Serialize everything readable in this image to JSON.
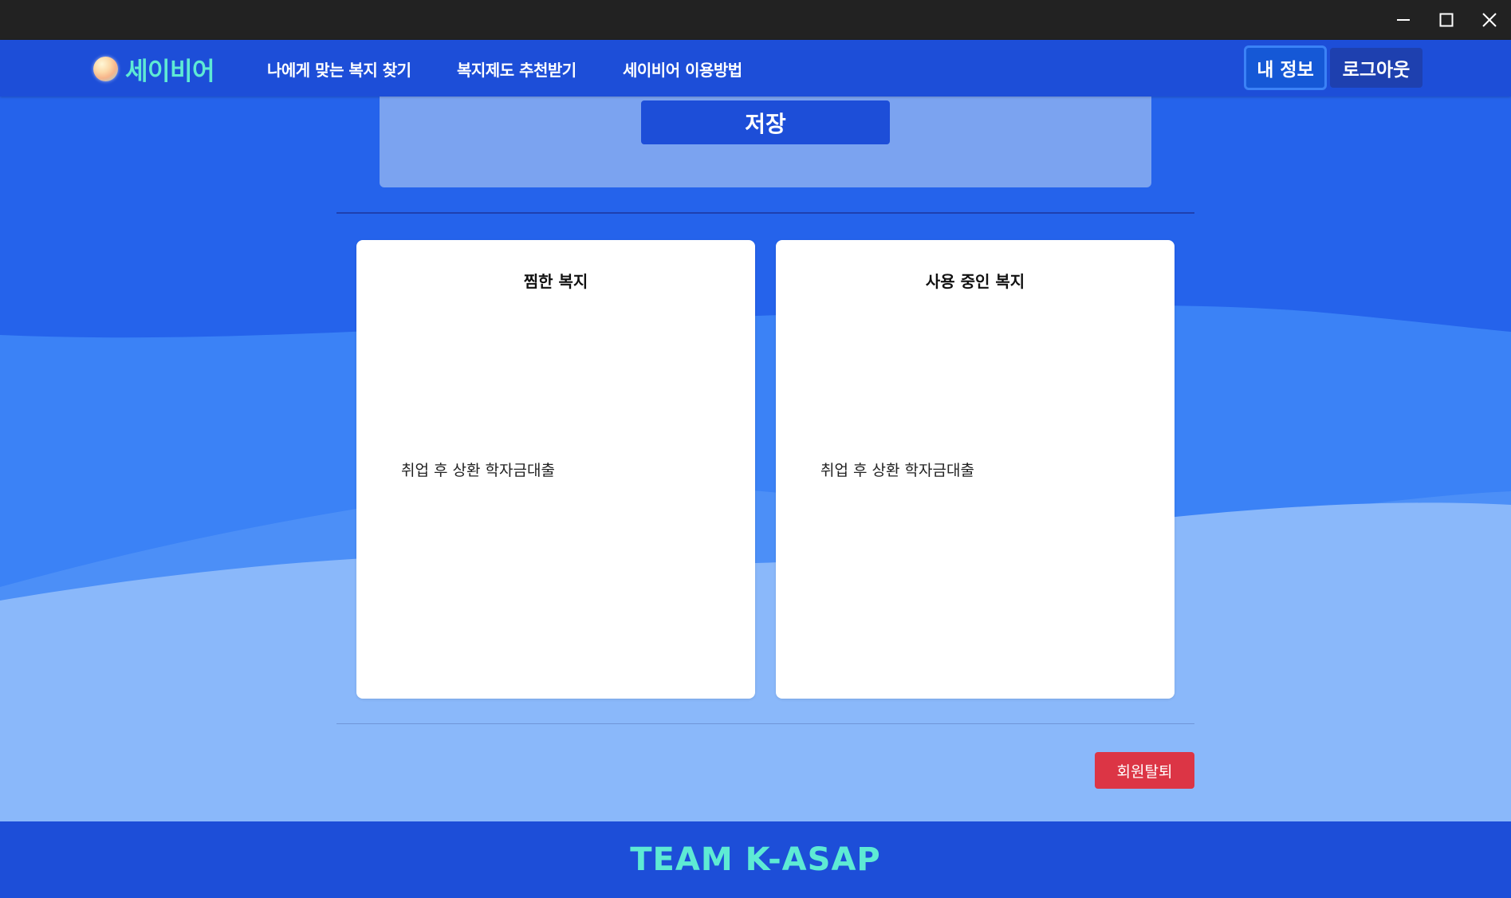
{
  "window": {
    "controls": [
      "minimize-icon",
      "maximize-icon",
      "close-icon"
    ]
  },
  "navbar": {
    "logo_text": "세이비어",
    "links": [
      {
        "label": "나에게 맞는 복지 찾기"
      },
      {
        "label": "복지제도 추천받기"
      },
      {
        "label": "세이비어 이용방법"
      }
    ],
    "myinfo_label": "내 정보",
    "logout_label": "로그아웃"
  },
  "panel": {
    "save_label": "저장"
  },
  "cards": [
    {
      "title": "찜한 복지",
      "items": [
        "취업 후 상환 학자금대출"
      ]
    },
    {
      "title": "사용 중인 복지",
      "items": [
        "취업 후 상환 학자금대출"
      ]
    }
  ],
  "withdraw_label": "회원탈퇴",
  "footer": {
    "text": "TEAM K-ASAP"
  },
  "colors": {
    "navbar": "#1d4ed8",
    "background_top": "#2563eb",
    "wave_mid": "#3b82f6",
    "wave_light": "#8ab8fa",
    "accent_text": "#5eead4",
    "danger": "#dc3545"
  }
}
